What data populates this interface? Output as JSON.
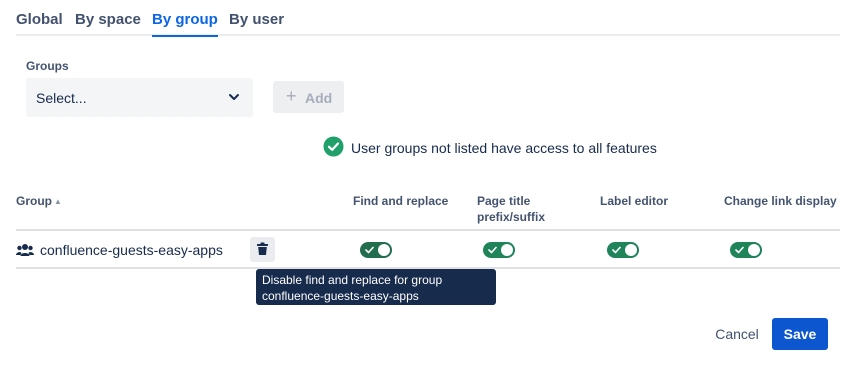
{
  "tabs": [
    {
      "label": "Global",
      "active": false
    },
    {
      "label": "By space",
      "active": false
    },
    {
      "label": "By group",
      "active": true
    },
    {
      "label": "By user",
      "active": false
    }
  ],
  "groups_field": {
    "label": "Groups",
    "selected": "Select...",
    "icon": "chevron-down-icon"
  },
  "add_button": {
    "label": "Add",
    "icon": "plus-icon",
    "disabled": true
  },
  "notice": {
    "text": "User groups not listed have access to all features",
    "icon": "check-circle-icon",
    "color": "#22a06b"
  },
  "table": {
    "columns": [
      "Group",
      "Find and replace",
      "Page title\nprefix/suffix",
      "Label editor",
      "Change link display"
    ],
    "rows": [
      {
        "group": "confluence-guests-easy-apps",
        "icon": "people-icon",
        "toggles": [
          true,
          true,
          true,
          true
        ]
      }
    ]
  },
  "tooltip": {
    "text": "Disable find and replace for group confluence-guests-easy-apps"
  },
  "footer": {
    "cancel_label": "Cancel",
    "save_label": "Save"
  },
  "colors": {
    "accent": "#0c66e4",
    "toggle_on": "#1f845a",
    "save_bg": "#0c57d0"
  }
}
